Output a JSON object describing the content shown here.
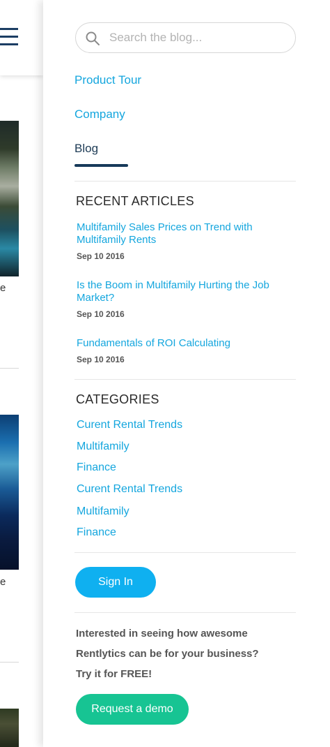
{
  "background_page": {
    "snippet_1": "e",
    "snippet_2": "e"
  },
  "search": {
    "placeholder": "Search the blog...",
    "icon": "search-icon"
  },
  "nav": {
    "items": [
      {
        "label": "Product Tour",
        "active": false
      },
      {
        "label": "Company",
        "active": false
      },
      {
        "label": "Blog",
        "active": true
      }
    ]
  },
  "recent_articles": {
    "heading": "RECENT ARTICLES",
    "items": [
      {
        "title": "Multifamily Sales Prices on Trend with Multifamily Rents",
        "date": "Sep 10 2016"
      },
      {
        "title": "Is the Boom in Multifamily Hurting the Job Market?",
        "date": "Sep 10 2016"
      },
      {
        "title": "Fundamentals of ROI Calculating",
        "date": "Sep 10 2016"
      }
    ]
  },
  "categories": {
    "heading": "CATEGORIES",
    "items": [
      "Curent Rental Trends",
      "Multifamily",
      "Finance",
      "Curent Rental Trends",
      "Multifamily",
      "Finance"
    ]
  },
  "account": {
    "signin_label": "Sign In"
  },
  "promo": {
    "line_1": "Interested in seeing how awesome",
    "line_2": "Rentlytics can be for your business?",
    "line_3": "Try it for FREE!",
    "cta_label": "Request a demo"
  },
  "colors": {
    "link": "#14a6de",
    "active_nav": "#1d3b55",
    "signin_button": "#0fb0f0",
    "demo_button": "#17c493"
  }
}
